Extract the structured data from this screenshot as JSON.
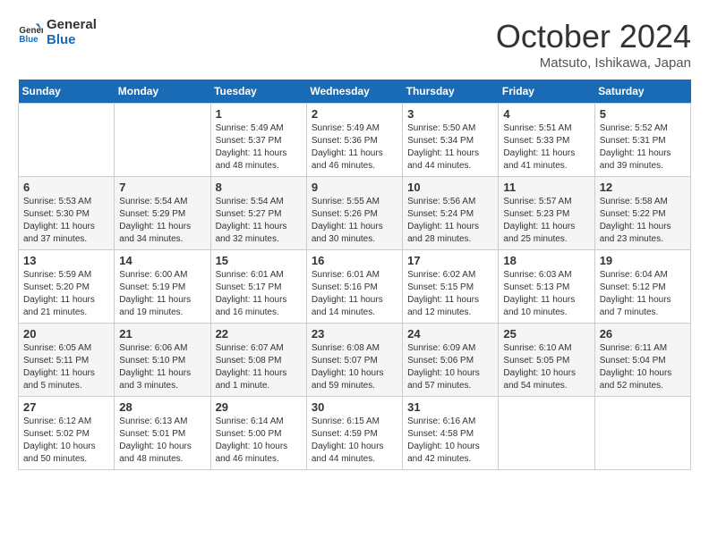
{
  "header": {
    "logo_line1": "General",
    "logo_line2": "Blue",
    "title": "October 2024",
    "location": "Matsuto, Ishikawa, Japan"
  },
  "weekdays": [
    "Sunday",
    "Monday",
    "Tuesday",
    "Wednesday",
    "Thursday",
    "Friday",
    "Saturday"
  ],
  "weeks": [
    [
      {
        "day": "",
        "sunrise": "",
        "sunset": "",
        "daylight": ""
      },
      {
        "day": "",
        "sunrise": "",
        "sunset": "",
        "daylight": ""
      },
      {
        "day": "1",
        "sunrise": "Sunrise: 5:49 AM",
        "sunset": "Sunset: 5:37 PM",
        "daylight": "Daylight: 11 hours and 48 minutes."
      },
      {
        "day": "2",
        "sunrise": "Sunrise: 5:49 AM",
        "sunset": "Sunset: 5:36 PM",
        "daylight": "Daylight: 11 hours and 46 minutes."
      },
      {
        "day": "3",
        "sunrise": "Sunrise: 5:50 AM",
        "sunset": "Sunset: 5:34 PM",
        "daylight": "Daylight: 11 hours and 44 minutes."
      },
      {
        "day": "4",
        "sunrise": "Sunrise: 5:51 AM",
        "sunset": "Sunset: 5:33 PM",
        "daylight": "Daylight: 11 hours and 41 minutes."
      },
      {
        "day": "5",
        "sunrise": "Sunrise: 5:52 AM",
        "sunset": "Sunset: 5:31 PM",
        "daylight": "Daylight: 11 hours and 39 minutes."
      }
    ],
    [
      {
        "day": "6",
        "sunrise": "Sunrise: 5:53 AM",
        "sunset": "Sunset: 5:30 PM",
        "daylight": "Daylight: 11 hours and 37 minutes."
      },
      {
        "day": "7",
        "sunrise": "Sunrise: 5:54 AM",
        "sunset": "Sunset: 5:29 PM",
        "daylight": "Daylight: 11 hours and 34 minutes."
      },
      {
        "day": "8",
        "sunrise": "Sunrise: 5:54 AM",
        "sunset": "Sunset: 5:27 PM",
        "daylight": "Daylight: 11 hours and 32 minutes."
      },
      {
        "day": "9",
        "sunrise": "Sunrise: 5:55 AM",
        "sunset": "Sunset: 5:26 PM",
        "daylight": "Daylight: 11 hours and 30 minutes."
      },
      {
        "day": "10",
        "sunrise": "Sunrise: 5:56 AM",
        "sunset": "Sunset: 5:24 PM",
        "daylight": "Daylight: 11 hours and 28 minutes."
      },
      {
        "day": "11",
        "sunrise": "Sunrise: 5:57 AM",
        "sunset": "Sunset: 5:23 PM",
        "daylight": "Daylight: 11 hours and 25 minutes."
      },
      {
        "day": "12",
        "sunrise": "Sunrise: 5:58 AM",
        "sunset": "Sunset: 5:22 PM",
        "daylight": "Daylight: 11 hours and 23 minutes."
      }
    ],
    [
      {
        "day": "13",
        "sunrise": "Sunrise: 5:59 AM",
        "sunset": "Sunset: 5:20 PM",
        "daylight": "Daylight: 11 hours and 21 minutes."
      },
      {
        "day": "14",
        "sunrise": "Sunrise: 6:00 AM",
        "sunset": "Sunset: 5:19 PM",
        "daylight": "Daylight: 11 hours and 19 minutes."
      },
      {
        "day": "15",
        "sunrise": "Sunrise: 6:01 AM",
        "sunset": "Sunset: 5:17 PM",
        "daylight": "Daylight: 11 hours and 16 minutes."
      },
      {
        "day": "16",
        "sunrise": "Sunrise: 6:01 AM",
        "sunset": "Sunset: 5:16 PM",
        "daylight": "Daylight: 11 hours and 14 minutes."
      },
      {
        "day": "17",
        "sunrise": "Sunrise: 6:02 AM",
        "sunset": "Sunset: 5:15 PM",
        "daylight": "Daylight: 11 hours and 12 minutes."
      },
      {
        "day": "18",
        "sunrise": "Sunrise: 6:03 AM",
        "sunset": "Sunset: 5:13 PM",
        "daylight": "Daylight: 11 hours and 10 minutes."
      },
      {
        "day": "19",
        "sunrise": "Sunrise: 6:04 AM",
        "sunset": "Sunset: 5:12 PM",
        "daylight": "Daylight: 11 hours and 7 minutes."
      }
    ],
    [
      {
        "day": "20",
        "sunrise": "Sunrise: 6:05 AM",
        "sunset": "Sunset: 5:11 PM",
        "daylight": "Daylight: 11 hours and 5 minutes."
      },
      {
        "day": "21",
        "sunrise": "Sunrise: 6:06 AM",
        "sunset": "Sunset: 5:10 PM",
        "daylight": "Daylight: 11 hours and 3 minutes."
      },
      {
        "day": "22",
        "sunrise": "Sunrise: 6:07 AM",
        "sunset": "Sunset: 5:08 PM",
        "daylight": "Daylight: 11 hours and 1 minute."
      },
      {
        "day": "23",
        "sunrise": "Sunrise: 6:08 AM",
        "sunset": "Sunset: 5:07 PM",
        "daylight": "Daylight: 10 hours and 59 minutes."
      },
      {
        "day": "24",
        "sunrise": "Sunrise: 6:09 AM",
        "sunset": "Sunset: 5:06 PM",
        "daylight": "Daylight: 10 hours and 57 minutes."
      },
      {
        "day": "25",
        "sunrise": "Sunrise: 6:10 AM",
        "sunset": "Sunset: 5:05 PM",
        "daylight": "Daylight: 10 hours and 54 minutes."
      },
      {
        "day": "26",
        "sunrise": "Sunrise: 6:11 AM",
        "sunset": "Sunset: 5:04 PM",
        "daylight": "Daylight: 10 hours and 52 minutes."
      }
    ],
    [
      {
        "day": "27",
        "sunrise": "Sunrise: 6:12 AM",
        "sunset": "Sunset: 5:02 PM",
        "daylight": "Daylight: 10 hours and 50 minutes."
      },
      {
        "day": "28",
        "sunrise": "Sunrise: 6:13 AM",
        "sunset": "Sunset: 5:01 PM",
        "daylight": "Daylight: 10 hours and 48 minutes."
      },
      {
        "day": "29",
        "sunrise": "Sunrise: 6:14 AM",
        "sunset": "Sunset: 5:00 PM",
        "daylight": "Daylight: 10 hours and 46 minutes."
      },
      {
        "day": "30",
        "sunrise": "Sunrise: 6:15 AM",
        "sunset": "Sunset: 4:59 PM",
        "daylight": "Daylight: 10 hours and 44 minutes."
      },
      {
        "day": "31",
        "sunrise": "Sunrise: 6:16 AM",
        "sunset": "Sunset: 4:58 PM",
        "daylight": "Daylight: 10 hours and 42 minutes."
      },
      {
        "day": "",
        "sunrise": "",
        "sunset": "",
        "daylight": ""
      },
      {
        "day": "",
        "sunrise": "",
        "sunset": "",
        "daylight": ""
      }
    ]
  ]
}
